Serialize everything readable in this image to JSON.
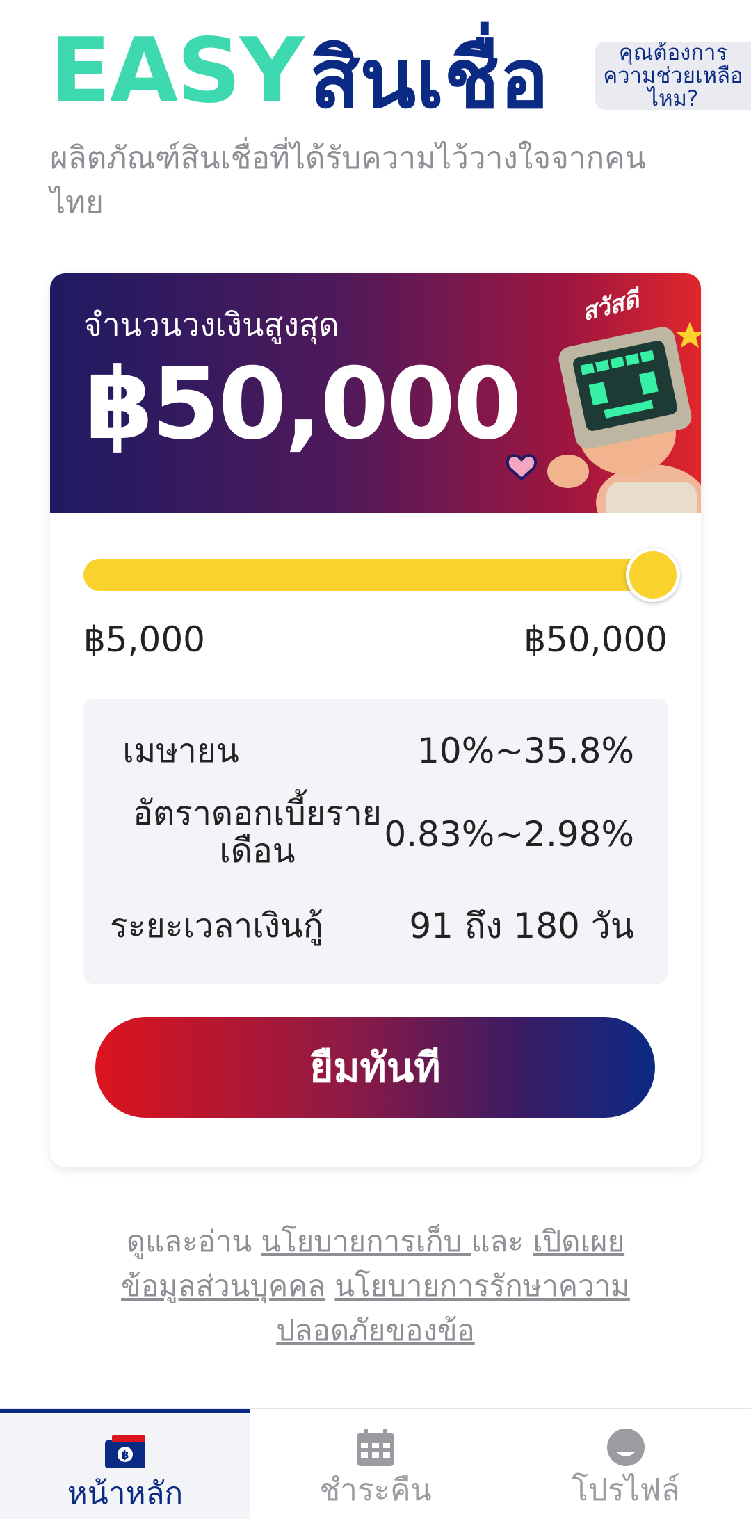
{
  "header": {
    "brand_easy": "EASY",
    "brand_thai": "สินเชื่อ",
    "help_label": "คุณต้องการความช่วยเหลือไหม?",
    "subtitle": "ผลิตภัณฑ์สินเชื่อที่ได้รับความไว้วางใจจากคนไทย"
  },
  "card": {
    "banner_label": "จำนวนวงเงินสูงสุด",
    "banner_amount": "฿50,000",
    "mascot_text": "สวัสดี",
    "slider": {
      "min_label": "฿5,000",
      "max_label": "฿50,000",
      "value_fraction": 1.0
    },
    "details": [
      {
        "label": "เมษายน",
        "value": "10%~35.8%"
      },
      {
        "label": "อัตราดอกเบี้ยรายเดือน",
        "value": "0.83%~2.98%"
      },
      {
        "label": "ระยะเวลาเงินกู้",
        "value": "91 ถึง 180 วัน"
      }
    ],
    "cta_label": "ยืมทันที"
  },
  "policy": {
    "prefix": "ดูและอ่าน ",
    "link1": "นโยบายการเก็บ ",
    "and": " และ ",
    "link2": "เปิดเผยข้อมูลส่วนบุคคล",
    "space": " ",
    "link3": "นโยบายการรักษาความปลอดภัยของข้อ"
  },
  "nav": {
    "home": "หน้าหลัก",
    "repay": "ชำระคืน",
    "profile": "โปรไฟล์"
  },
  "colors": {
    "brand_teal": "#3fd9b0",
    "brand_navy": "#0b2a83",
    "slider_yellow": "#f9d22e",
    "cta_red": "#dc141e"
  }
}
